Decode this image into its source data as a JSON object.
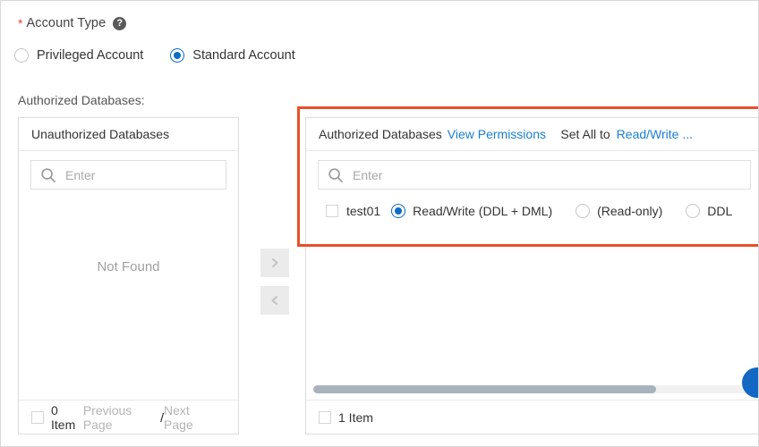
{
  "form": {
    "required_marker": "*",
    "account_type_label": "Account Type",
    "help_icon": "question-mark-circle-icon",
    "account_types": [
      {
        "label": "Privileged Account",
        "selected": false
      },
      {
        "label": "Standard Account",
        "selected": true
      }
    ],
    "authorized_databases_caption": "Authorized Databases:"
  },
  "left_panel": {
    "header_title": "Unauthorized Databases",
    "search": {
      "icon": "search-icon",
      "placeholder": "Enter",
      "value": ""
    },
    "empty_message": "Not Found",
    "footer": {
      "count_label": "0 Item",
      "select_all_checked": false,
      "pager": {
        "previous_label": "Previous Page",
        "separator": "/",
        "next_label": "Next Page",
        "disabled": true
      }
    }
  },
  "transfer_buttons": {
    "move_right_icon": "chevron-right-icon",
    "move_left_icon": "chevron-left-icon"
  },
  "right_panel": {
    "header_title": "Authorized Databases",
    "view_permissions_link": "View Permissions",
    "set_all_static": "Set All to",
    "set_all_link": "Read/Write ...",
    "search": {
      "icon": "search-icon",
      "placeholder": "Enter",
      "value": ""
    },
    "rows": [
      {
        "checked": false,
        "name": "test01",
        "permissions": [
          {
            "label": "Read/Write (DDL + DML)",
            "selected": true
          },
          {
            "label": "(Read-only)",
            "selected": false
          },
          {
            "label": "DDL",
            "selected": false,
            "truncated": true
          }
        ]
      }
    ],
    "scrollbar": {
      "orientation": "horizontal",
      "thumb_fraction": 0.77
    },
    "footer": {
      "count_label": "1 Item",
      "select_all_checked": false
    }
  },
  "annotation": {
    "type": "highlight-rectangle",
    "color": "#e8502a"
  },
  "floating_button": {
    "color": "#1268c3",
    "shape": "circle"
  },
  "colors": {
    "accent_blue": "#0d6cc4",
    "link_blue": "#1a7fd4",
    "required_red": "#e8443a",
    "annotation_orange": "#e8502a",
    "panel_border": "#dcdcdc",
    "scroll_thumb": "#a8b2bd"
  }
}
